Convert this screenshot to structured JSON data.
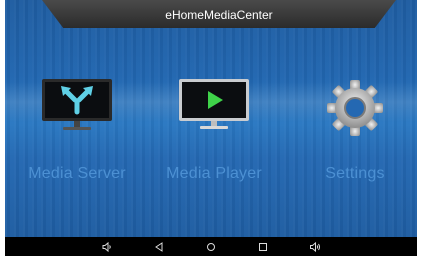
{
  "app": {
    "title": "eHomeMediaCenter"
  },
  "menu": {
    "items": [
      {
        "label": "Media Server",
        "icon": "media-server-icon"
      },
      {
        "label": "Media Player",
        "icon": "media-player-icon"
      },
      {
        "label": "Settings",
        "icon": "gear-icon"
      }
    ]
  },
  "nav": {
    "buttons": [
      "volume-down-icon",
      "back-icon",
      "home-icon",
      "recents-icon",
      "volume-up-icon"
    ]
  },
  "colors": {
    "background": "#2166b0",
    "label": "#4c90d3",
    "play_green": "#3fd24a",
    "arrows_cyan": "#5fd0e6"
  }
}
